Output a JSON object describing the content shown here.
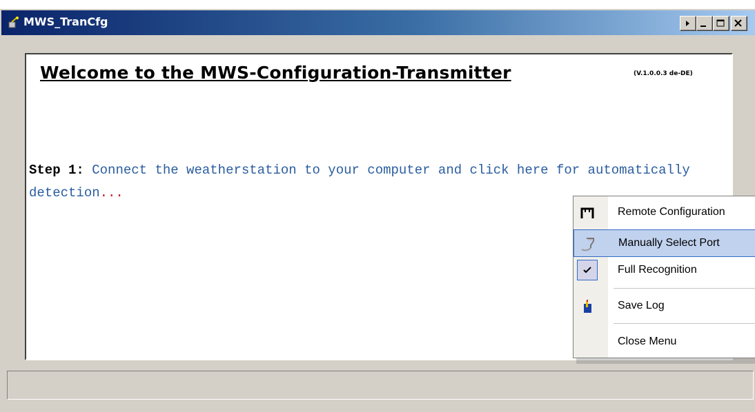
{
  "window": {
    "title": "MWS_TranCfg"
  },
  "content": {
    "headline": "Welcome to the MWS-Configuration-Transmitter",
    "version": "(V.1.0.0.3 de-DE)",
    "step_label": "Step 1:",
    "step_text": "Connect the weatherstation to your computer and click here for automatically detection",
    "step_dots": "..."
  },
  "menu": {
    "items": [
      {
        "label": "Remote Configuration",
        "icon": "remote-config-icon"
      },
      {
        "label": "Manually Select Port",
        "icon": "serial-port-icon"
      },
      {
        "label": "Full Recognition",
        "icon": "checkmark-icon",
        "checked": true
      },
      {
        "label": "Save Log",
        "icon": "save-log-icon"
      },
      {
        "label": "Close Menu",
        "icon": ""
      }
    ]
  },
  "colors": {
    "titlebar_start": "#0a246a",
    "titlebar_end": "#a6caf0",
    "step_text": "#2a5d9f",
    "menu_highlight": "#c1d2ee",
    "dots": "#c01818"
  }
}
